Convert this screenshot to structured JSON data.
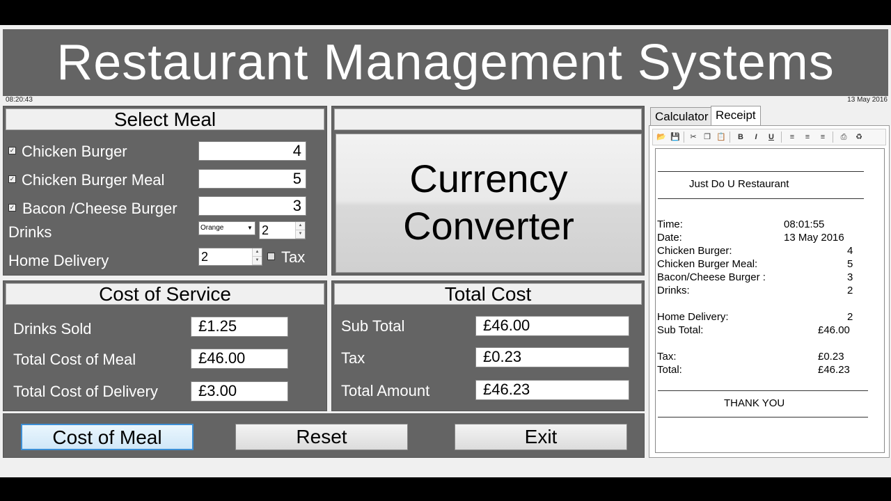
{
  "app": {
    "title": "Restaurant Management Systems",
    "time": "08:20:43",
    "date": "13 May 2016"
  },
  "select_meal": {
    "heading": "Select Meal",
    "items": [
      {
        "label": "Chicken Burger",
        "checked": true,
        "qty": "4"
      },
      {
        "label": "Chicken Burger Meal",
        "checked": true,
        "qty": "5"
      },
      {
        "label": "Bacon /Cheese Burger",
        "checked": true,
        "qty": "3"
      }
    ],
    "drinks_label": "Drinks",
    "drink_choice": "Orange",
    "drink_qty": "2",
    "delivery_label": "Home Delivery",
    "delivery_qty": "2",
    "tax_label": "Tax",
    "tax_checked": false
  },
  "currency": {
    "button_line1": "Currency",
    "button_line2": "Converter"
  },
  "cost_of_service": {
    "heading": "Cost of Service",
    "rows": [
      {
        "label": "Drinks Sold",
        "value": "£1.25"
      },
      {
        "label": "Total Cost of Meal",
        "value": "£46.00"
      },
      {
        "label": "Total Cost of Delivery",
        "value": "£3.00"
      }
    ]
  },
  "total_cost": {
    "heading": "Total Cost",
    "rows": [
      {
        "label": "Sub Total",
        "value": "£46.00"
      },
      {
        "label": "Tax",
        "value": "£0.23"
      },
      {
        "label": "Total Amount",
        "value": "£46.23"
      }
    ]
  },
  "actions": {
    "cost_of_meal": "Cost of Meal",
    "reset": "Reset",
    "exit": "Exit"
  },
  "tabs": {
    "calculator": "Calculator",
    "receipt": "Receipt"
  },
  "toolbar_icons": [
    "open-icon",
    "save-icon",
    "cut-icon",
    "copy-icon",
    "paste-icon",
    "bold-icon",
    "italic-icon",
    "underline-icon",
    "align-left-icon",
    "align-center-icon",
    "align-right-icon",
    "print-icon",
    "clear-icon"
  ],
  "receipt": {
    "restaurant": "Just Do U Restaurant",
    "rows": [
      {
        "label": "Time:",
        "value": "08:01:55"
      },
      {
        "label": "Date:",
        "value": "13 May 2016"
      },
      {
        "label": "Chicken Burger:",
        "value": "4"
      },
      {
        "label": "Chicken Burger Meal:",
        "value": "5"
      },
      {
        "label": "Bacon/Cheese Burger :",
        "value": "3"
      },
      {
        "label": "Drinks:",
        "value": "2"
      },
      {
        "label": "Home Delivery:",
        "value": "2"
      },
      {
        "label": "Sub Total:",
        "value": "£46.00"
      },
      {
        "label": "Tax:",
        "value": "£0.23"
      },
      {
        "label": "Total:",
        "value": "£46.23"
      }
    ],
    "footer": "THANK YOU"
  }
}
